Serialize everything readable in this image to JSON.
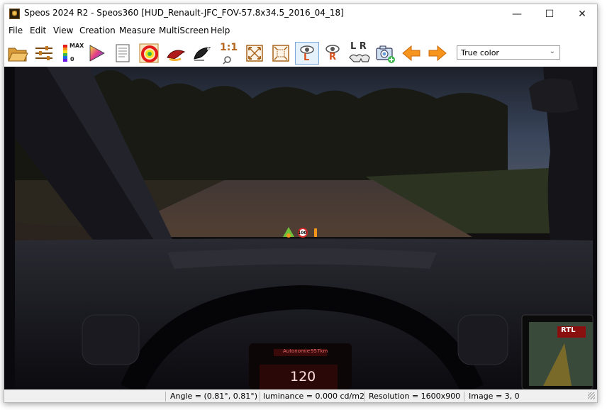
{
  "window": {
    "title": "Speos 2024 R2 - Speos360 [HUD_Renault-JFC_FOV-57.8x34.5_2016_04_18]",
    "minimize_glyph": "—",
    "maximize_glyph": "☐",
    "close_glyph": "✕"
  },
  "menu": [
    "File",
    "Edit",
    "View",
    "Creation",
    "Measure",
    "MultiScreen",
    "Help"
  ],
  "toolbar": {
    "max_label": "MAX",
    "zero_label": "0",
    "one_to_one": "1:1",
    "eye_left_letter": "L",
    "eye_right_letter": "R",
    "stereo_label": "L R",
    "color_mode": "True color",
    "icons": [
      "open-folder-icon",
      "levels-icon",
      "color-scale-max-icon",
      "color-triangle-icon",
      "document-icon",
      "color-wheel-icon",
      "paint-brush-icon",
      "brush-black-icon",
      "zoom-one-to-one-icon",
      "fit-all-icon",
      "fit-region-icon",
      "eye-left-icon",
      "eye-right-icon",
      "stereo-glasses-icon",
      "camera-add-icon",
      "arrow-left-icon",
      "arrow-right-icon"
    ]
  },
  "hud": {
    "speed_limit": "100",
    "dash_small_text": "Autonomie",
    "dash_range": "957km",
    "dash_speed": "120",
    "radio_label": "RTL"
  },
  "status": {
    "angle": "Angle = (0.81°, 0.81°)",
    "luminance": "luminance = 0.000 cd/m2",
    "resolution": "Resolution = 1600x900",
    "image": "Image = 3, 0"
  },
  "colors": {
    "arrow_orange": "#f7941d",
    "hud_green": "#6fbf3a",
    "dash_red": "#d42a2a",
    "sky_blue": "#5874a8"
  }
}
